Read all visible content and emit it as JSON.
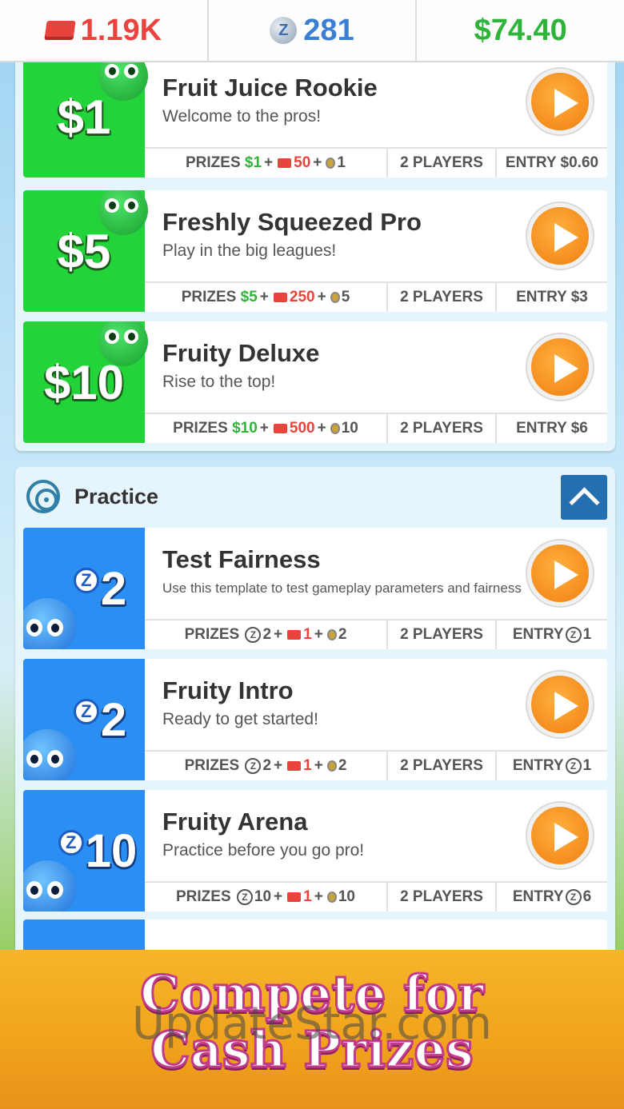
{
  "topbar": {
    "tickets": "1.19K",
    "z_coins": "281",
    "cash": "$74.40"
  },
  "cash_games": [
    {
      "badge": "$1",
      "title": "Fruit Juice Rookie",
      "subtitle": "Welcome to the pros!",
      "prizes_label": "PRIZES",
      "prize_cash": "$1",
      "prize_tickets": "50",
      "prize_medals": "1",
      "players": "2 PLAYERS",
      "entry": "ENTRY $0.60"
    },
    {
      "badge": "$5",
      "title": "Freshly Squeezed Pro",
      "subtitle": "Play in the big leagues!",
      "prizes_label": "PRIZES",
      "prize_cash": "$5",
      "prize_tickets": "250",
      "prize_medals": "5",
      "players": "2 PLAYERS",
      "entry": "ENTRY $3"
    },
    {
      "badge": "$10",
      "title": "Fruity Deluxe",
      "subtitle": "Rise to the top!",
      "prizes_label": "PRIZES",
      "prize_cash": "$10",
      "prize_tickets": "500",
      "prize_medals": "10",
      "players": "2 PLAYERS",
      "entry": "ENTRY $6"
    }
  ],
  "practice": {
    "label": "Practice",
    "games": [
      {
        "badge_value": "2",
        "title": "Test Fairness",
        "subtitle": "Use this template to test gameplay parameters and fairness",
        "prizes_label": "PRIZES",
        "prize_z": "2",
        "prize_tickets": "1",
        "prize_medals": "2",
        "players": "2 PLAYERS",
        "entry_label": "ENTRY",
        "entry_value": "1"
      },
      {
        "badge_value": "2",
        "title": "Fruity Intro",
        "subtitle": "Ready to get started!",
        "prizes_label": "PRIZES",
        "prize_z": "2",
        "prize_tickets": "1",
        "prize_medals": "2",
        "players": "2 PLAYERS",
        "entry_label": "ENTRY",
        "entry_value": "1"
      },
      {
        "badge_value": "10",
        "title": "Fruity Arena",
        "subtitle": "Practice before you go pro!",
        "prizes_label": "PRIZES",
        "prize_z": "10",
        "prize_tickets": "1",
        "prize_medals": "10",
        "players": "2 PLAYERS",
        "entry_label": "ENTRY",
        "entry_value": "6"
      }
    ]
  },
  "promo": {
    "line1": "Compete for",
    "line2": "Cash Prizes",
    "watermark": "UpdateStar.com"
  },
  "icons": {
    "z_symbol": "Z",
    "plus": "+"
  },
  "colors": {
    "cash_green": "#2fb43a",
    "ticket_red": "#e8433d",
    "z_blue": "#3a7fd4",
    "play_orange": "#f59a20",
    "promo_orange": "#f6b52a"
  }
}
